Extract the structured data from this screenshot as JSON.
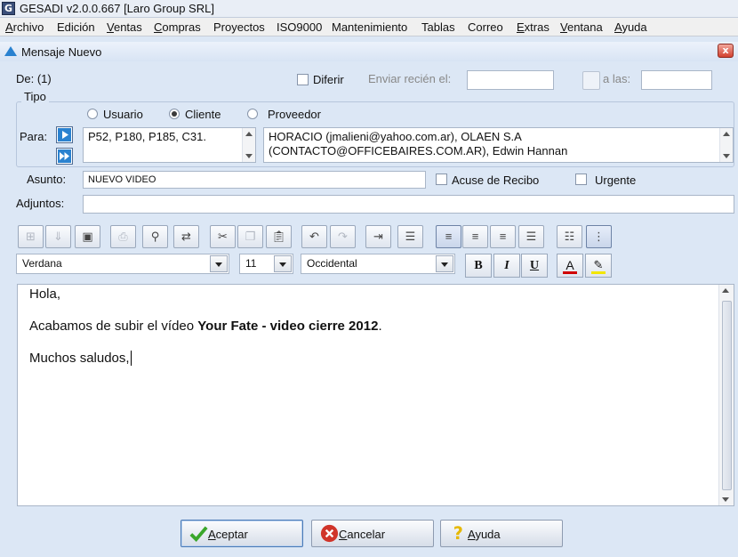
{
  "window": {
    "title": "GESADI v2.0.0.667 [Laro Group SRL]",
    "icon_letter": "G"
  },
  "menu": [
    "Archivo",
    "Edición",
    "Ventas",
    "Compras",
    "Proyectos",
    "ISO9000",
    "Mantenimiento",
    "Tablas",
    "Correo",
    "Extras",
    "Ventana",
    "Ayuda"
  ],
  "dialog": {
    "title": "Mensaje Nuevo",
    "close_glyph": "x"
  },
  "form": {
    "de_label": "De: (1)",
    "diferir_label": "Diferir",
    "enviar_label": "Enviar recién el:",
    "enviar_value": "",
    "alas_label": "a las:",
    "alas_value": "",
    "tipo_label": "Tipo",
    "radios": {
      "usuario": "Usuario",
      "cliente": "Cliente",
      "proveedor": "Proveedor",
      "selected": "Cliente"
    },
    "para_label": "Para:",
    "para_codes": "P52, P180, P185, C31.",
    "para_contacts_line1": "HORACIO (jmalieni@yahoo.com.ar), OLAEN S.A",
    "para_contacts_line2": "(CONTACTO@OFFICEBAIRES.COM.AR), Edwin Hannan",
    "asunto_label": "Asunto:",
    "asunto_value": "NUEVO VIDEO",
    "acuse_label": "Acuse de Recibo",
    "urgente_label": "Urgente",
    "adjuntos_label": "Adjuntos:",
    "adjuntos_value": ""
  },
  "format_bar": {
    "font": "Verdana",
    "size": "11",
    "charset": "Occidental",
    "bold": "B",
    "italic": "I",
    "underline": "U",
    "font_color": "A"
  },
  "message": {
    "line1": "Hola,",
    "line2_prefix": "Acabamos de subir el vídeo ",
    "line2_bold": "Your Fate - video cierre 2012",
    "line2_suffix": ".",
    "line3": "Muchos saludos,"
  },
  "buttons": {
    "aceptar": "Aceptar",
    "cancelar": "Cancelar",
    "ayuda": "Ayuda"
  },
  "colors": {
    "accent_blue": "#2a82d0",
    "font_color_underline": "#d00000",
    "highlight": "#f2e600",
    "ok_green": "#3aa62a",
    "cancel_red": "#d0342a"
  }
}
